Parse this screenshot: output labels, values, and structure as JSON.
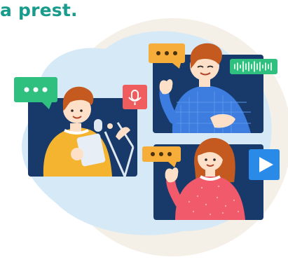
{
  "headline": {
    "text": "a prest."
  },
  "colors": {
    "headline": "#1a9c8c",
    "backdrop_beige": "#f4efe7",
    "backdrop_blue": "#d6e9f7",
    "tile_navy": "#173a6b",
    "chat_green": "#2fbf7e",
    "chat_orange": "#f6ad3a",
    "mic_red": "#f05d5e",
    "play_blue": "#2a8ae8",
    "shirt_yellow": "#f4b430",
    "shirt_blue": "#3d7de0",
    "shirt_pink": "#f05a6a"
  },
  "illustration": {
    "icons": [
      "chat-bubble-icon",
      "microphone-icon",
      "sound-wave-icon",
      "play-icon"
    ]
  }
}
